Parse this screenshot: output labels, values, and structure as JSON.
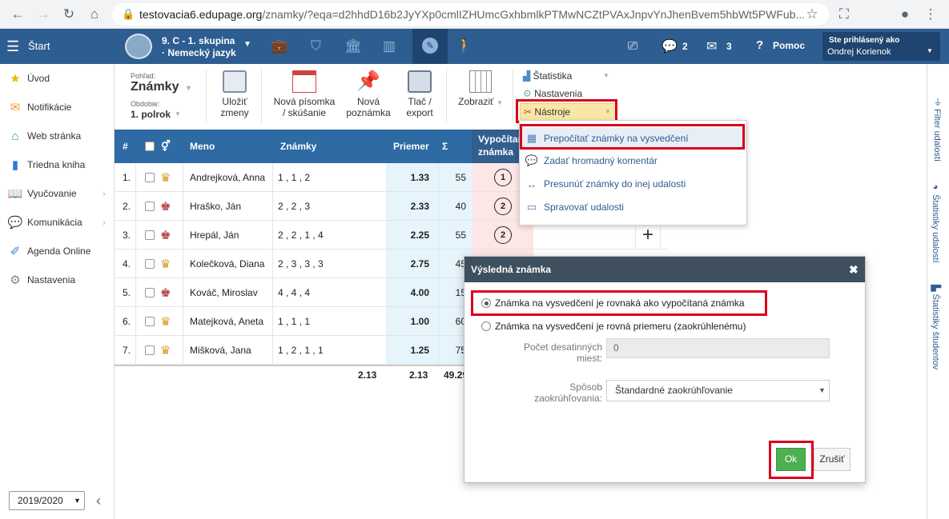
{
  "browser": {
    "url_host": "testovacia6.edupage.org",
    "url_path": "/znamky/?eqa=d2hhdD16b2JyYXp0cmlIZHUmcGxhbmlkPTMwNCZtPVAxJnpvYnJhenBvem5hbWt5PWFub..."
  },
  "topbar": {
    "start_label": "Štart",
    "class_line1": "9. C - 1. skupina",
    "class_line2": "· Nemecký jazyk",
    "chat_count": "2",
    "mail_count": "3",
    "help_label": "Pomoc",
    "logged_label": "Ste prihlásený ako",
    "user_name": "Ondrej Korienok"
  },
  "sidebar": {
    "items": [
      {
        "label": "Úvod",
        "icon": "star-icon"
      },
      {
        "label": "Notifikácie",
        "icon": "envelope-icon"
      },
      {
        "label": "Web stránka",
        "icon": "home-icon"
      },
      {
        "label": "Triedna kniha",
        "icon": "book-icon"
      },
      {
        "label": "Vyučovanie",
        "icon": "open-book-icon"
      },
      {
        "label": "Komunikácia",
        "icon": "chat-icon"
      },
      {
        "label": "Agenda Online",
        "icon": "pen-icon"
      },
      {
        "label": "Nastavenia",
        "icon": "gear-icon"
      }
    ],
    "year": "2019/2020"
  },
  "toolbar": {
    "view_caption": "Pohľad:",
    "view_value": "Známky",
    "period_caption": "Obdobie:",
    "period_value": "1. polrok",
    "save_l1": "Uložiť",
    "save_l2": "zmeny",
    "new_test_l1": "Nová písomka",
    "new_test_l2": "/ skúšanie",
    "new_note_l1": "Nová",
    "new_note_l2": "poznámka",
    "print_l1": "Tlač /",
    "print_l2": "export",
    "show_label": "Zobraziť",
    "stats_label": "Štatistika",
    "settings_label": "Nastavenia",
    "tools_label": "Nástroje"
  },
  "table": {
    "headers": {
      "num": "#",
      "name": "Meno",
      "grades": "Známky",
      "avg": "Priemer",
      "sum": "Σ",
      "calc_l1": "Vypočítan",
      "calc_l2": "známka"
    },
    "rows": [
      {
        "n": "1.",
        "name": "Andrejková, Anna",
        "grades": "1 ,  1 ,  2",
        "avg": "1.33",
        "sum": "55",
        "calc": "1",
        "gender": "female"
      },
      {
        "n": "2.",
        "name": "Hraško, Ján",
        "grades": "2 ,  2 ,  3",
        "avg": "2.33",
        "sum": "40",
        "calc": "2",
        "gender": "male"
      },
      {
        "n": "3.",
        "name": "Hrepál, Ján",
        "grades": "2 ,  2 ,  1 ,  4",
        "avg": "2.25",
        "sum": "55",
        "calc": "2",
        "gender": "male"
      },
      {
        "n": "4.",
        "name": "Kolečková, Diana",
        "grades": "2 ,  3 ,  3 ,  3",
        "avg": "2.75",
        "sum": "45",
        "calc": "",
        "gender": "female"
      },
      {
        "n": "5.",
        "name": "Kováč, Miroslav",
        "grades": "4 ,  4 ,  4",
        "avg": "4.00",
        "sum": "15",
        "calc": "",
        "gender": "male"
      },
      {
        "n": "6.",
        "name": "Matejková, Aneta",
        "grades": "1 ,  1 ,  1",
        "avg": "1.00",
        "sum": "60",
        "calc": "",
        "gender": "female"
      },
      {
        "n": "7.",
        "name": "Mišková, Jana",
        "grades": "1 ,  2 ,  1 ,  1",
        "avg": "1.25",
        "sum": "75",
        "calc": "",
        "gender": "female"
      }
    ],
    "footer": {
      "total_a": "2.13",
      "total_b": "2.13",
      "total_c": "49.29"
    }
  },
  "menu": {
    "items": [
      {
        "label": "Prepočítať známky na vysvedčení",
        "icon": "calculator-icon"
      },
      {
        "label": "Zadať hromadný komentár",
        "icon": "comment-icon"
      },
      {
        "label": "Presunúť známky do inej udalosti",
        "icon": "move-arrows-icon"
      },
      {
        "label": "Spravovať udalosti",
        "icon": "calendar-icon"
      }
    ]
  },
  "dialog": {
    "title": "Výsledná známka",
    "option1": "Známka na vysvedčení je rovnaká ako vypočítaná známka",
    "option2": "Známka na vysvedčení je rovná priemeru (zaokrúhlenému)",
    "decimals_l1": "Počet desatinných",
    "decimals_l2": "miest:",
    "decimals_value": "0",
    "rounding_l1": "Spôsob",
    "rounding_l2": "zaokrúhľovania:",
    "rounding_value": "Štandardné zaokrúhľovanie",
    "ok_label": "Ok",
    "cancel_label": "Zrušiť"
  },
  "rail": {
    "filter": "Filter udalostí",
    "event_stats": "Štatistiky udalostí",
    "student_stats": "Štatistiky študentov"
  },
  "colors": {
    "topbar": "#2e5d92",
    "header": "#2e6aa3",
    "highlight": "#d9001b",
    "ok": "#4caf50"
  }
}
